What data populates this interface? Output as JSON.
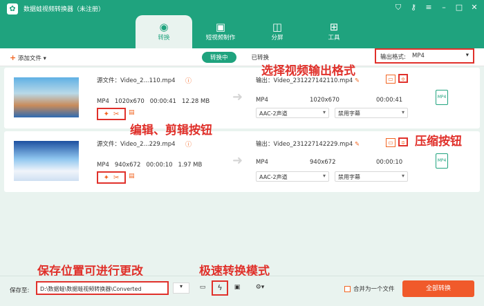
{
  "app": {
    "title": "数据蛙视频转换器（未注册）",
    "logo": "✿"
  },
  "window_icons": [
    "cart-icon",
    "key-icon",
    "menu-icon",
    "minimize-icon",
    "maximize-icon",
    "close-icon"
  ],
  "tabs": [
    {
      "label": "转换",
      "icon": "convert-icon",
      "active": true
    },
    {
      "label": "短视频制作",
      "icon": "short-video-icon",
      "active": false
    },
    {
      "label": "分屏",
      "icon": "split-screen-icon",
      "active": false
    },
    {
      "label": "工具",
      "icon": "toolbox-icon",
      "active": false
    }
  ],
  "toolbar": {
    "add_file": "添加文件",
    "converting": "转换中",
    "converted": "已转换",
    "output_format_label": "输出格式:",
    "output_format_value": "MP4"
  },
  "files": [
    {
      "source": "源文件：Video_2...110.mp4",
      "format": "MP4",
      "resolution": "1020x670",
      "duration": "00:00:41",
      "size": "12.28 MB",
      "output_name": "输出：Video_231227142110.mp4",
      "out_format": "MP4",
      "out_resolution": "1020x670",
      "out_duration": "00:00:41",
      "audio": "AAC-2声道",
      "subtitle": "禁用字幕"
    },
    {
      "source": "源文件：Video_2...229.mp4",
      "format": "MP4",
      "resolution": "940x672",
      "duration": "00:00:10",
      "size": "1.97 MB",
      "output_name": "输出：Video_231227142229.mp4",
      "out_format": "MP4",
      "out_resolution": "940x672",
      "out_duration": "00:00:10",
      "audio": "AAC-2声道",
      "subtitle": "禁用字幕"
    }
  ],
  "annotations": {
    "format": "选择视频输出格式",
    "edit": "编辑、剪辑按钮",
    "compress": "压缩按钮",
    "save": "保存位置可进行更改",
    "speed": "极速转换模式"
  },
  "bottom": {
    "save_label": "保存至:",
    "save_path": "D:\\数据蛙\\数据蛙视频转换器\\Converted",
    "merge": "合并为一个文件",
    "convert_all": "全部转换"
  },
  "colors": {
    "brand": "#1fa37e",
    "accent": "#f05a2b",
    "highlight": "#e0302a"
  }
}
